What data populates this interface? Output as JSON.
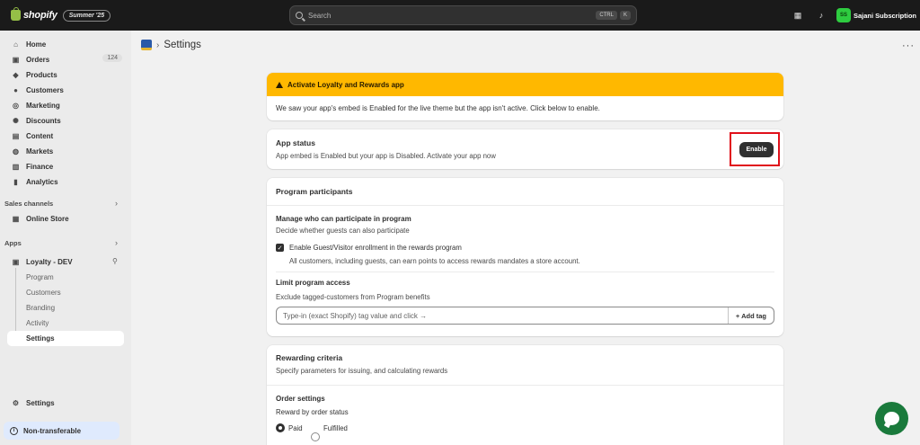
{
  "topbar": {
    "brand": "shopify",
    "edition": "Summer '25",
    "search_placeholder": "Search",
    "shortcut_keys": [
      "CTRL",
      "K"
    ],
    "store_initials": "SS",
    "store_name": "Sajani Subscription"
  },
  "sidebar": {
    "nav": [
      {
        "label": "Home",
        "icon": "home-icon",
        "glyph": "⌂"
      },
      {
        "label": "Orders",
        "icon": "orders-icon",
        "glyph": "▣",
        "badge": "124"
      },
      {
        "label": "Products",
        "icon": "tag-icon",
        "glyph": "◆"
      },
      {
        "label": "Customers",
        "icon": "person-icon",
        "glyph": "●"
      },
      {
        "label": "Marketing",
        "icon": "target-icon",
        "glyph": "◎"
      },
      {
        "label": "Discounts",
        "icon": "discount-icon",
        "glyph": "✺"
      },
      {
        "label": "Content",
        "icon": "content-icon",
        "glyph": "▤"
      },
      {
        "label": "Markets",
        "icon": "globe-icon",
        "glyph": "◍"
      },
      {
        "label": "Finance",
        "icon": "bank-icon",
        "glyph": "▥"
      },
      {
        "label": "Analytics",
        "icon": "bar-chart-icon",
        "glyph": "▮"
      }
    ],
    "sales_channels_label": "Sales channels",
    "online_store": "Online Store",
    "apps_label": "Apps",
    "app_name": "Loyalty - DEV",
    "app_sub": [
      "Program",
      "Customers",
      "Branding",
      "Activity",
      "Settings"
    ],
    "settings": "Settings",
    "non_transferable": "Non-transferable"
  },
  "page": {
    "title": "Settings"
  },
  "banner": {
    "title": "Activate Loyalty and Rewards app",
    "body": "We saw your app's embed is Enabled for the live theme but the app isn't active. Click below to enable."
  },
  "app_status": {
    "title": "App status",
    "description": "App embed is Enabled but your app is Disabled. Activate your app now",
    "button": "Enable"
  },
  "participants": {
    "title": "Program participants",
    "manage_title": "Manage who can participate in program",
    "manage_desc": "Decide whether guests can also participate",
    "checkbox_label": "Enable Guest/Visitor enrollment in the rewards program",
    "checkbox_checked": true,
    "checkbox_help": "All customers, including guests, can earn points to access rewards mandates a store account.",
    "limit_title": "Limit program access",
    "limit_desc": "Exclude tagged-customers from Program benefits",
    "tag_placeholder": "Type-in (exact Shopify) tag value and click →",
    "add_tag": "+ Add tag"
  },
  "rewarding": {
    "title": "Rewarding criteria",
    "desc": "Specify parameters for issuing, and calculating rewards",
    "order_settings": "Order settings",
    "reward_by": "Reward by order status",
    "options": [
      "Paid",
      "Fulfilled"
    ],
    "selected": "Paid"
  }
}
